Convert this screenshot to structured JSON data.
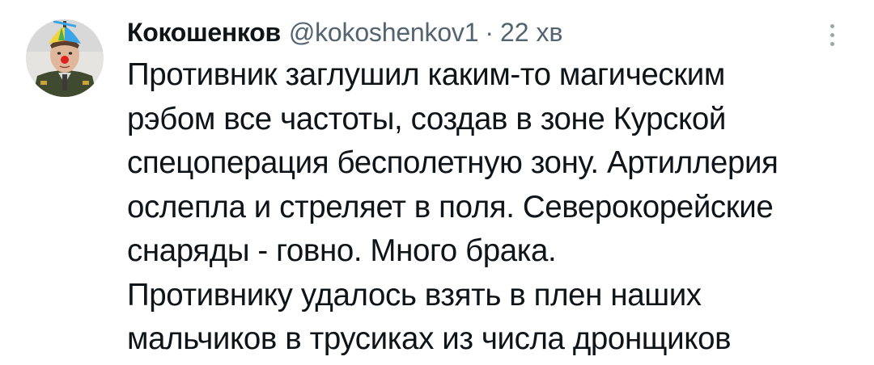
{
  "tweet": {
    "author": {
      "display_name": "Кокошенков",
      "handle": "@kokoshenkov1",
      "avatar_icon": "user-avatar"
    },
    "separator": "·",
    "time": "22 хв",
    "more_icon": "more-vertical-icon",
    "text_lines": [
      "Противник заглушил каким-то магическим",
      "рэбом все частоты, создав в зоне Курской",
      "спецоперация бесполетную зону. Артиллерия",
      "ослепла и стреляет в поля. Северокорейские",
      "снаряды - говно. Много брака.",
      "Противнику удалось взять в плен наших",
      "мальчиков в трусиках из числа дронщиков"
    ]
  },
  "colors": {
    "text": "#0f1419",
    "secondary": "#536471",
    "background": "#ffffff"
  }
}
